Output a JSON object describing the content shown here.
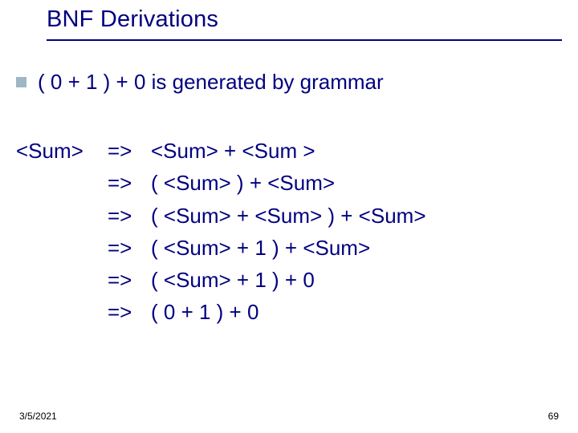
{
  "slide": {
    "title": "BNF Derivations",
    "bullet": "( 0 + 1 ) + 0  is generated by grammar",
    "derivation": {
      "lhs": "<Sum>",
      "steps": [
        "<Sum> + <Sum >",
        "( <Sum> ) + <Sum>",
        "( <Sum> + <Sum> ) + <Sum>",
        "( <Sum> + 1 ) + <Sum>",
        "( <Sum> + 1 ) + 0",
        "( 0 + 1 ) + 0"
      ],
      "arrow": "=>"
    },
    "footer": {
      "date": "3/5/2021",
      "page": "69"
    }
  }
}
